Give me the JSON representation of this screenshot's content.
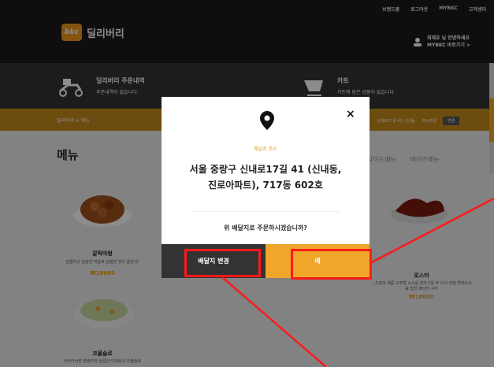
{
  "header": {
    "top_links": [
      "브랜드홈",
      "로그아웃",
      "MYBKC",
      "고객센터"
    ],
    "logo_badge": "bkc",
    "logo_text": "딜리버리",
    "user_greeting": "최재호 님 안녕하세요",
    "user_link": "MYBKC 바로가기 >"
  },
  "band": {
    "orders_title": "딜리버리 주문내역",
    "orders_sub": "주문내역이 없습니다.",
    "cart_title": "카트",
    "cart_sub": "카트에 담은 상품이 없습니다."
  },
  "breadcrumb": {
    "text": "딜리버리  >  메뉴",
    "address_short": "신내로17길 41 신내동,",
    "address_change": "주소변경",
    "button": "변경"
  },
  "main": {
    "menu_title": "메뉴",
    "categories": [
      "사이드메뉴",
      "바이츠메뉴"
    ],
    "items": [
      {
        "name": "갈릭마왕",
        "desc": "달콤하고 달달한 마늘로 감칠맛 맛이 골린다!",
        "price": "₩18000"
      },
      {
        "name": "로스터",
        "desc": "...조겠게 매콤 고추장 소스를 발라구운 후 다시 한번 핫베스소를 입힌 매다리 구이",
        "price": "₩18000"
      },
      {
        "name": "코울슬로",
        "desc": "아삭아삭한 양배추와 상큼한 드레싱의 코울슬로",
        "price": ""
      }
    ]
  },
  "modal": {
    "label": "배달지 주소",
    "address_line1": "서울 중랑구 신내로17길 41 (신내동,",
    "address_line2": "진로아파트), 717동 602호",
    "question": "위 배달지로 주문하시겠습니까?",
    "change_button": "배달지 변경",
    "confirm_button": "예",
    "close_label": "×"
  },
  "colors": {
    "accent": "#f0a62a",
    "dark": "#333333",
    "annotation": "#ff1a1a"
  }
}
